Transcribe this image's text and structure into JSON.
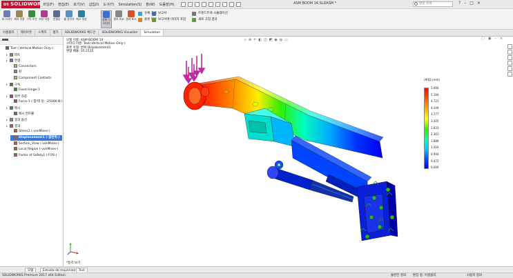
{
  "app": {
    "logo_text": "SOLIDWORKS",
    "logo_mark": "DS",
    "document_title": "ASM BOOM 14.SLDASM *",
    "search_placeholder": "명령 검색",
    "window_buttons": [
      "?",
      "–",
      "□",
      "×"
    ]
  },
  "menubar": [
    "파일(F)",
    "편집(E)",
    "보기(V)",
    "삽입(I)",
    "도구(T)",
    "Simulation(S)",
    "창(W)",
    "도움말(H)"
  ],
  "ribbon": {
    "buttons": [
      {
        "label": "새 스터디",
        "icon": "new-study-icon",
        "color": "#6b7fb5"
      },
      {
        "label": "재료 적용",
        "icon": "apply-material-icon",
        "color": "#9b8855"
      },
      {
        "label": "구속 조건",
        "icon": "fixture-icon",
        "color": "#3d8a3d"
      },
      {
        "label": "외부 하중",
        "icon": "external-load-icon",
        "color": "#b13c8e"
      },
      {
        "label": "연결부",
        "icon": "connections-icon",
        "color": "#5c6d93"
      },
      {
        "label": "쉘 관리자",
        "icon": "shell-manager-icon",
        "color": "#5a8fc4"
      },
      {
        "label": "메시 생성",
        "icon": "mesh-icon",
        "color": "#2f7f9c"
      },
      {
        "label": "실행 이 스터디",
        "icon": "run-study-icon",
        "color": "#3b6fd1"
      },
      {
        "label": "결과 비교",
        "icon": "compare-results-icon",
        "color": "#888"
      },
      {
        "label": "결과 표시",
        "icon": "result-plot-icon",
        "color": "#d9532a"
      }
    ],
    "small": [
      {
        "label": "유체 흐름",
        "icon": "flow-icon",
        "color": "#44a0d8"
      },
      {
        "label": "플롯 도구",
        "icon": "plot-tools-icon",
        "color": "#cc8822"
      },
      {
        "label": "보고서",
        "icon": "report-icon",
        "color": "#3f6fb8"
      },
      {
        "label": "보고서에 이미지 포함",
        "icon": "include-image-icon",
        "color": "#7a8f3a"
      },
      {
        "label": "트렌드트랙 시뮬레이션",
        "icon": "trend-tracker-icon",
        "color": "#777"
      },
      {
        "label": "새로 고침 결과",
        "icon": "refresh-icon",
        "color": "#669944"
      }
    ]
  },
  "command_tabs": [
    "어셈블리",
    "레이아웃",
    "스케치",
    "평가",
    "SOLIDWORKS 애드인",
    "SOLIDWORKS Visualize",
    "Simulation"
  ],
  "active_command_tab": "Simulation",
  "tree": {
    "nodes": [
      {
        "label": "Test (-Vertical Motion Only-)",
        "icon": "study-icon",
        "level": 0,
        "color": "#4466aa"
      },
      {
        "label": "파트",
        "icon": "parts-icon",
        "level": 1,
        "color": "#888"
      },
      {
        "label": "연결",
        "icon": "connections-folder-icon",
        "level": 1,
        "color": "#5b7fb0"
      },
      {
        "label": "Connectors",
        "icon": "folder-icon",
        "level": 2,
        "color": "#d9b34a"
      },
      {
        "label": "핀",
        "icon": "pin-icon",
        "level": 2,
        "color": "#888"
      },
      {
        "label": "Component Contacts",
        "icon": "folder-icon",
        "level": 2,
        "color": "#d9b34a"
      },
      {
        "label": "구속",
        "icon": "fixtures-icon",
        "level": 1,
        "color": "#3d8a3d"
      },
      {
        "label": "Fixed Hinge-1",
        "icon": "hinge-icon",
        "level": 2,
        "color": "#3d8a3d"
      },
      {
        "label": "외부 하중",
        "icon": "loads-icon",
        "level": 1,
        "color": "#b13c8e"
      },
      {
        "label": "Force-1 (:힘/력 당: -25000 N:)",
        "icon": "force-icon",
        "level": 2,
        "color": "#b13c8e"
      },
      {
        "label": "메시",
        "icon": "mesh-tree-icon",
        "level": 1,
        "color": "#2f7f9c"
      },
      {
        "label": "메시 컨트롤",
        "icon": "mesh-control-icon",
        "level": 2,
        "color": "#2f7f9c"
      },
      {
        "label": "결과 옵션",
        "icon": "result-options-icon",
        "level": 1,
        "color": "#888"
      },
      {
        "label": "결과",
        "icon": "results-icon",
        "level": 1,
        "color": "#d9532a"
      },
      {
        "label": "Stress1 (-vonMises-)",
        "icon": "plot-icon",
        "level": 2,
        "color": "#d9532a"
      },
      {
        "label": "Displacement1 (-합변위-)",
        "icon": "plot-icon",
        "level": 2,
        "color": "#d9532a",
        "selected": true
      },
      {
        "label": "Section_View (-vonMises-)",
        "icon": "plot-icon",
        "level": 2,
        "color": "#d9532a"
      },
      {
        "label": "Local Region (-vonMises-)",
        "icon": "plot-icon",
        "level": 2,
        "color": "#d9532a"
      },
      {
        "label": "Factor of Safety1 (-FOS-)",
        "icon": "plot-icon",
        "level": 2,
        "color": "#d9532a"
      }
    ]
  },
  "viewport": {
    "info_lines": [
      "모델 이름: ASM BOOM 14",
      "스터디 이름: Test(-Vertical Motion Only-)",
      "플롯 유형: 변위 Displacement1",
      "변형 배율: 55.2115"
    ],
    "view_label": "*등각 보기",
    "legend": {
      "title": "URES (mm)",
      "values": [
        "5.666",
        "5.194",
        "4.721",
        "4.249",
        "3.777",
        "3.305",
        "2.833",
        "2.361",
        "1.889",
        "1.416",
        "0.944",
        "0.472",
        "0.000"
      ]
    }
  },
  "bottom_tabs": [
    "모델",
    "Estudio de movimiento 1",
    "Test"
  ],
  "active_bottom_tab": "Test",
  "status": {
    "left": "SOLIDWORKS Premium 2017 x64 Edition",
    "mid1": "불완전 정의",
    "mid2": "편집 중: 어셈블리",
    "right": "사용자 정의"
  }
}
